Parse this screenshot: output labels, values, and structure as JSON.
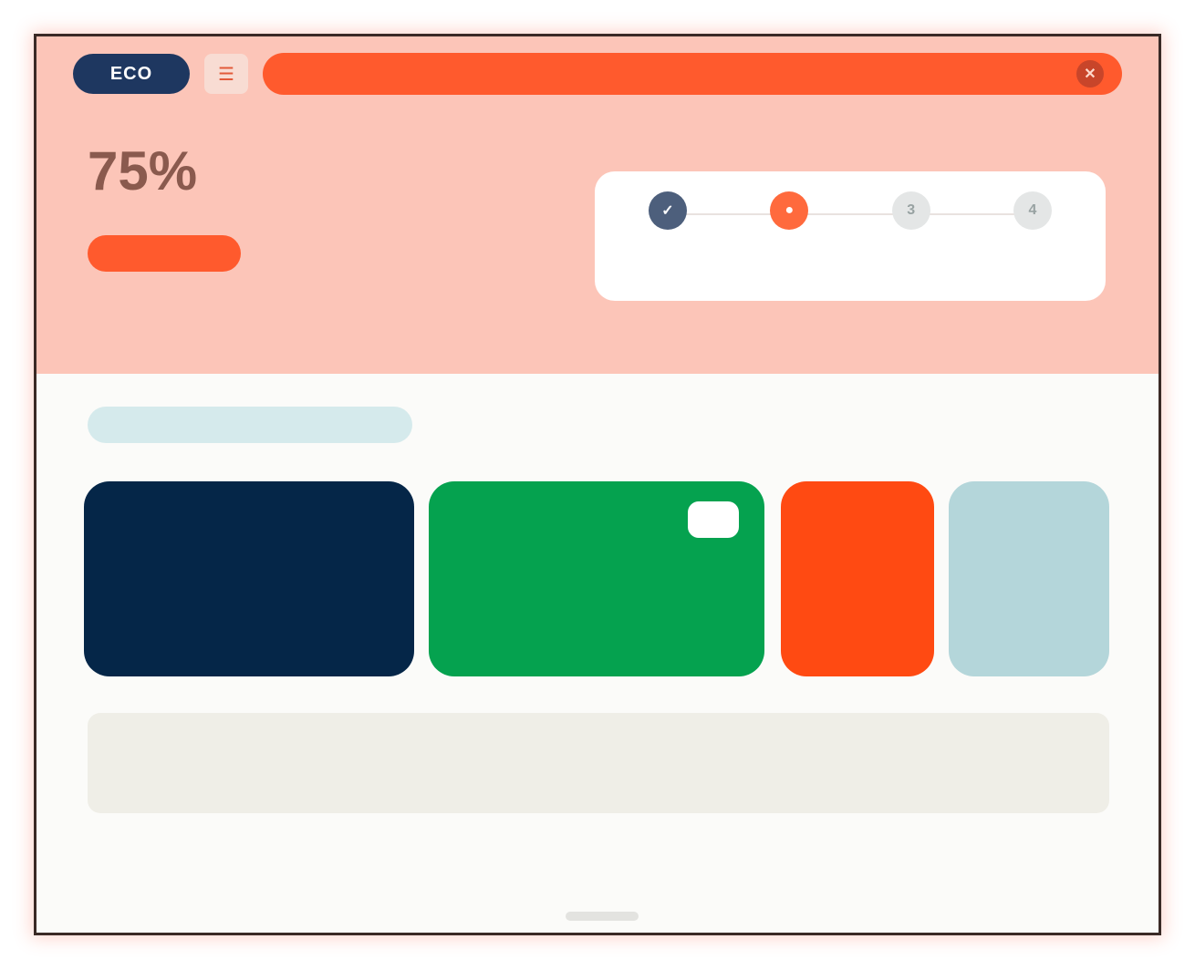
{
  "header": {
    "logo": "ECO",
    "nav_icon": "☰",
    "promo_text": "",
    "promo_close": "✕"
  },
  "hero": {
    "eyebrow": "",
    "percent": "75%",
    "subtitle": "",
    "cta_label": ""
  },
  "progress": {
    "steps": [
      {
        "glyph": "✓",
        "label": "",
        "state": "done"
      },
      {
        "glyph": "●",
        "label": "",
        "state": "current"
      },
      {
        "glyph": "3",
        "label": "",
        "state": "todo"
      },
      {
        "glyph": "4",
        "label": "",
        "state": "todo"
      }
    ]
  },
  "tabs": [
    {
      "label": ""
    },
    {
      "label": ""
    },
    {
      "label": ""
    }
  ],
  "cards": {
    "navy": {
      "title": "",
      "text": "",
      "foot": ""
    },
    "green": {
      "title": "",
      "badge": "",
      "foot": ""
    },
    "orange": {
      "title": "",
      "foot": ""
    },
    "sky": {
      "title": "",
      "foot": ""
    }
  },
  "stats": [
    {
      "value": "",
      "delta": ""
    },
    {
      "value": "",
      "delta": ""
    },
    {
      "value": "",
      "delta": ""
    },
    {
      "value": "",
      "delta": ""
    }
  ],
  "bottom": {
    "section_title": "",
    "view_all": "",
    "columns": [
      "",
      "",
      ""
    ]
  },
  "colors": {
    "hero_bg": "#fcc5b8",
    "accent": "#ff5a2d",
    "navy": "#052648",
    "green": "#05a24f",
    "orange": "#ff4a12",
    "sky": "#b4d6da"
  }
}
